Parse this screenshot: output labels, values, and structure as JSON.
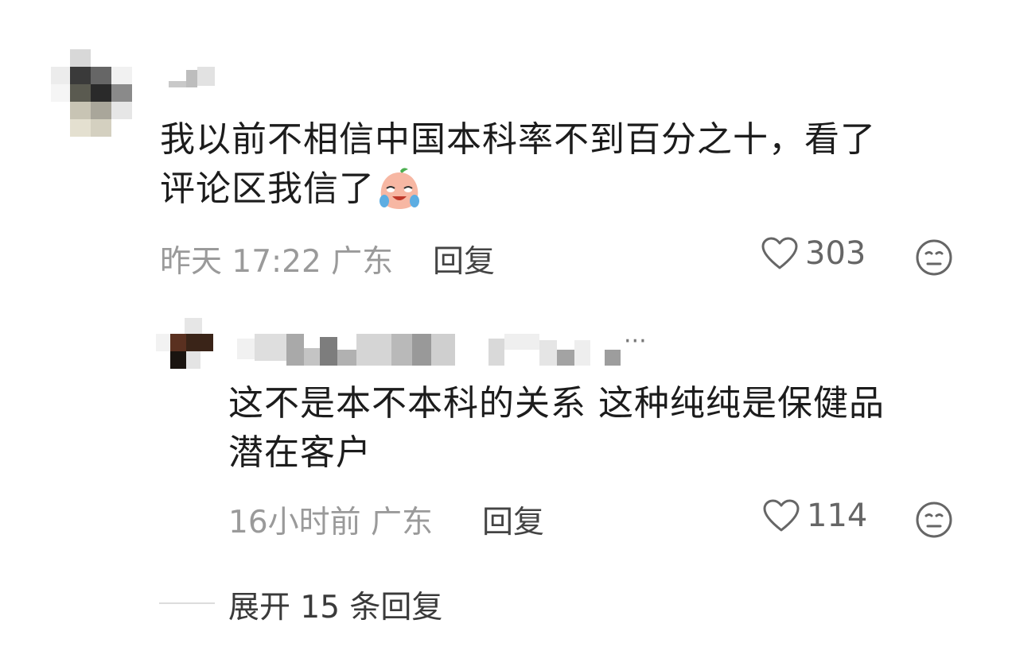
{
  "comment": {
    "text_line1": "我以前不相信中国本科率不到百分之十，看了",
    "text_line2": "评论区我信了",
    "emoji": "laughing-crying-peach-emoji",
    "time": "昨天 17:22 广东",
    "reply_label": "回复",
    "likes": "303"
  },
  "reply": {
    "ellipsis": "···",
    "text_line1": "这不是本不本科的关系 这种纯纯是保健品",
    "text_line2": "潜在客户",
    "time": "16小时前 广东",
    "reply_label": "回复",
    "likes": "114"
  },
  "expand": {
    "label": "展开 15 条回复"
  },
  "icons": {
    "like": "heart-outline-icon",
    "dislike": "neutral-face-icon"
  },
  "colors": {
    "text": "#1c1c1c",
    "meta": "#9a9a9a",
    "icon": "#666666"
  }
}
